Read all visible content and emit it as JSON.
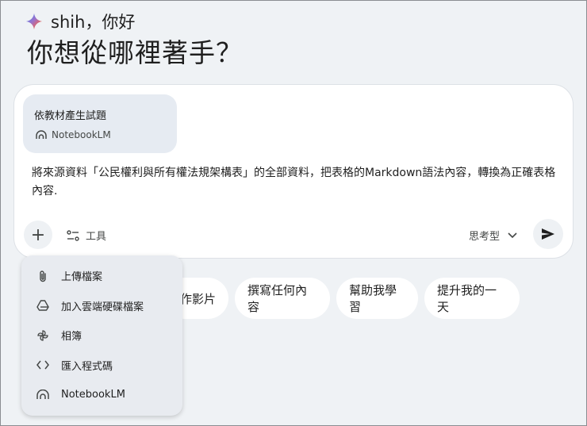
{
  "greeting": {
    "name": "shih，你好"
  },
  "headline": "你想從哪裡著手？",
  "composer": {
    "source_chip": {
      "title": "依教材產生試題",
      "source": "NotebookLM"
    },
    "prompt_text": "將來源資料「公民權利與所有權法規架構表」的全部資料，把表格的Markdown語法內容，轉換為正確表格內容.",
    "add_button": "+",
    "tools_label": "工具",
    "model_label": "思考型"
  },
  "suggestions": [
    "作影片",
    "撰寫任何內容",
    "幫助我學習",
    "提升我的一天"
  ],
  "menu": {
    "items": [
      {
        "label": "上傳檔案",
        "icon": "paperclip-icon"
      },
      {
        "label": "加入雲端硬碟檔案",
        "icon": "drive-icon"
      },
      {
        "label": "相簿",
        "icon": "photos-icon"
      },
      {
        "label": "匯入程式碼",
        "icon": "code-icon"
      },
      {
        "label": "NotebookLM",
        "icon": "notebooklm-icon"
      }
    ]
  }
}
